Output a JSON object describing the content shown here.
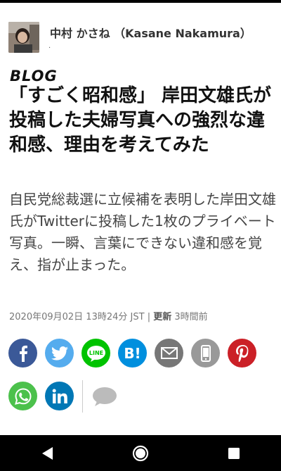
{
  "author": {
    "name": "中村 かさね （Kasane Nakamura）",
    "dot": "."
  },
  "blog_tag": "BLOG",
  "headline": "「すごく昭和感」 岸田文雄氏が投稿した夫婦写真への強烈な違和感、理由を考えてみた",
  "summary": "自民党総裁選に立候補を表明した岸田文雄氏がTwitterに投稿した1枚のプライベート写真。一瞬、言葉にできない違和感を覚え、指が止まった。",
  "meta": {
    "published": "2020年09月02日 13時24分 JST",
    "separator": "|",
    "updated_label": "更新",
    "updated_value": "3時間前"
  },
  "share": {
    "hatena_text": "B!",
    "line_text": "LINE",
    "colors": {
      "facebook": "#3b5998",
      "twitter": "#55acee",
      "line": "#00c300",
      "hatena": "#008fde",
      "email": "#777777",
      "mobile": "#999999",
      "pinterest": "#cb2027",
      "whatsapp": "#4cc14c",
      "linkedin": "#0077b5",
      "comment": "#bbbbbb"
    }
  }
}
